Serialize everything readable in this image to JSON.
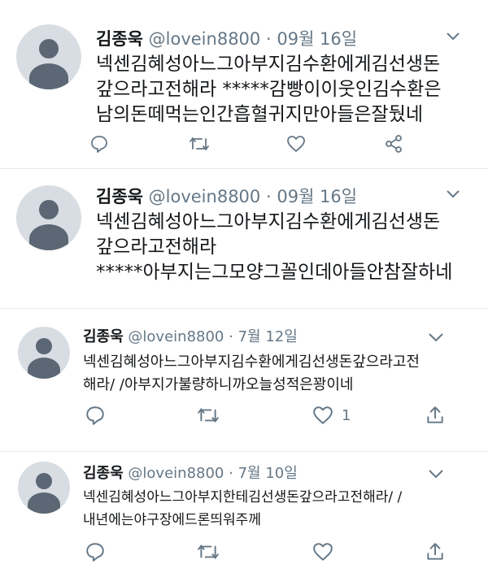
{
  "tweets": [
    {
      "author": "김종욱",
      "handle": "@lovein8800",
      "separator": "·",
      "date": "09월 16일",
      "lines": [
        "넥센김혜성아느그아부지김수환에게김선생돈",
        "갚으라고전해라 *****감빵이이웃인김수환은",
        "남의돈떼먹는인간흡혈귀지만아들은잘뒀네"
      ],
      "like_count": ""
    },
    {
      "author": "김종욱",
      "handle": "@lovein8800",
      "separator": "·",
      "date": "09월 16일",
      "lines": [
        "넥센김혜성아느그아부지김수환에게김선생돈",
        "갚으라고전해라",
        "*****아부지는그모양그꼴인데아들안참잘하네"
      ],
      "like_count": ""
    },
    {
      "author": "김종욱",
      "handle": "@lovein8800",
      "separator": "·",
      "date": "7월 12일",
      "lines": [
        "넥센김혜성아느그아부지김수환에게김선생돈갚으라고전",
        "해라/ /아부지가불량하니까오늘성적은꽝이네"
      ],
      "like_count": "1"
    },
    {
      "author": "김종욱",
      "handle": "@lovein8800",
      "separator": "·",
      "date": "7월 10일",
      "lines": [
        "넥센김혜성아느그아부지한테김선생돈갚으라고전해라/ /",
        "내년에는야구장에드론띄워주께"
      ],
      "like_count": ""
    }
  ],
  "icons": {
    "tweet1": [
      "reply-icon",
      "retweet-icon",
      "like-icon",
      "share-icon"
    ],
    "tweet2": [],
    "tweet3": [
      "reply-icon",
      "retweet-icon",
      "like-icon",
      "share-icon"
    ],
    "tweet4": [
      "reply-icon",
      "retweet-icon",
      "like-icon",
      "share-icon"
    ]
  },
  "colors": {
    "text": "#14171a",
    "secondary": "#657786",
    "divider": "#e6ecf0",
    "avatar_bg": "#d8dde3",
    "avatar_fg": "#5b6774"
  }
}
